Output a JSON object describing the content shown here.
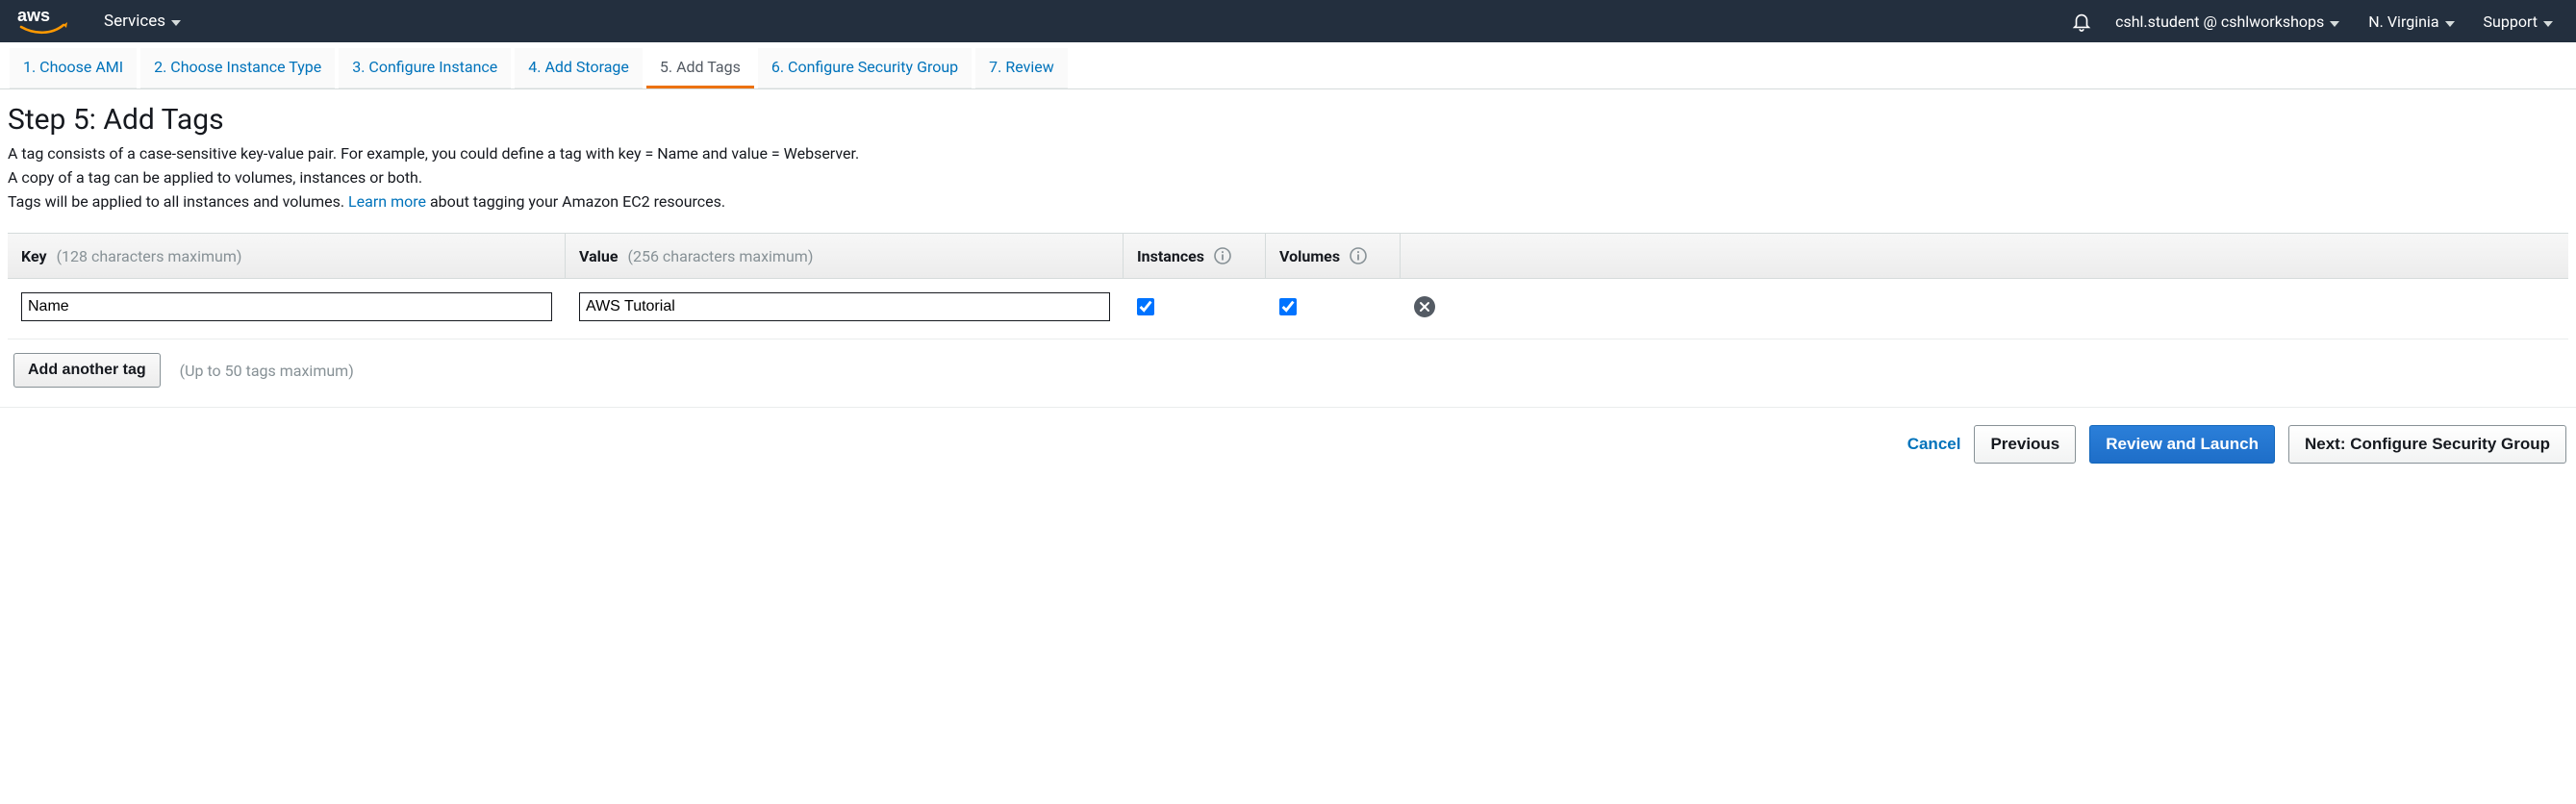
{
  "topnav": {
    "services_label": "Services",
    "account_label": "cshl.student @ cshlworkshops",
    "region_label": "N. Virginia",
    "support_label": "Support"
  },
  "wizard": {
    "steps": [
      {
        "label": "1. Choose AMI"
      },
      {
        "label": "2. Choose Instance Type"
      },
      {
        "label": "3. Configure Instance"
      },
      {
        "label": "4. Add Storage"
      },
      {
        "label": "5. Add Tags"
      },
      {
        "label": "6. Configure Security Group"
      },
      {
        "label": "7. Review"
      }
    ],
    "active_index": 4
  },
  "page": {
    "title": "Step 5: Add Tags",
    "desc_line1": "A tag consists of a case-sensitive key-value pair. For example, you could define a tag with key = Name and value = Webserver.",
    "desc_line2": "A copy of a tag can be applied to volumes, instances or both.",
    "desc_line3a": "Tags will be applied to all instances and volumes. ",
    "learn_more": "Learn more",
    "desc_line3b": " about tagging your Amazon EC2 resources."
  },
  "table": {
    "headers": {
      "key_label": "Key",
      "key_hint": "(128 characters maximum)",
      "value_label": "Value",
      "value_hint": "(256 characters maximum)",
      "instances_label": "Instances",
      "volumes_label": "Volumes"
    },
    "rows": [
      {
        "key": "Name",
        "value": "AWS Tutorial",
        "instances": true,
        "volumes": true
      }
    ],
    "add_button": "Add another tag",
    "add_hint": "(Up to 50 tags maximum)"
  },
  "footer": {
    "cancel": "Cancel",
    "previous": "Previous",
    "review_launch": "Review and Launch",
    "next": "Next: Configure Security Group"
  }
}
